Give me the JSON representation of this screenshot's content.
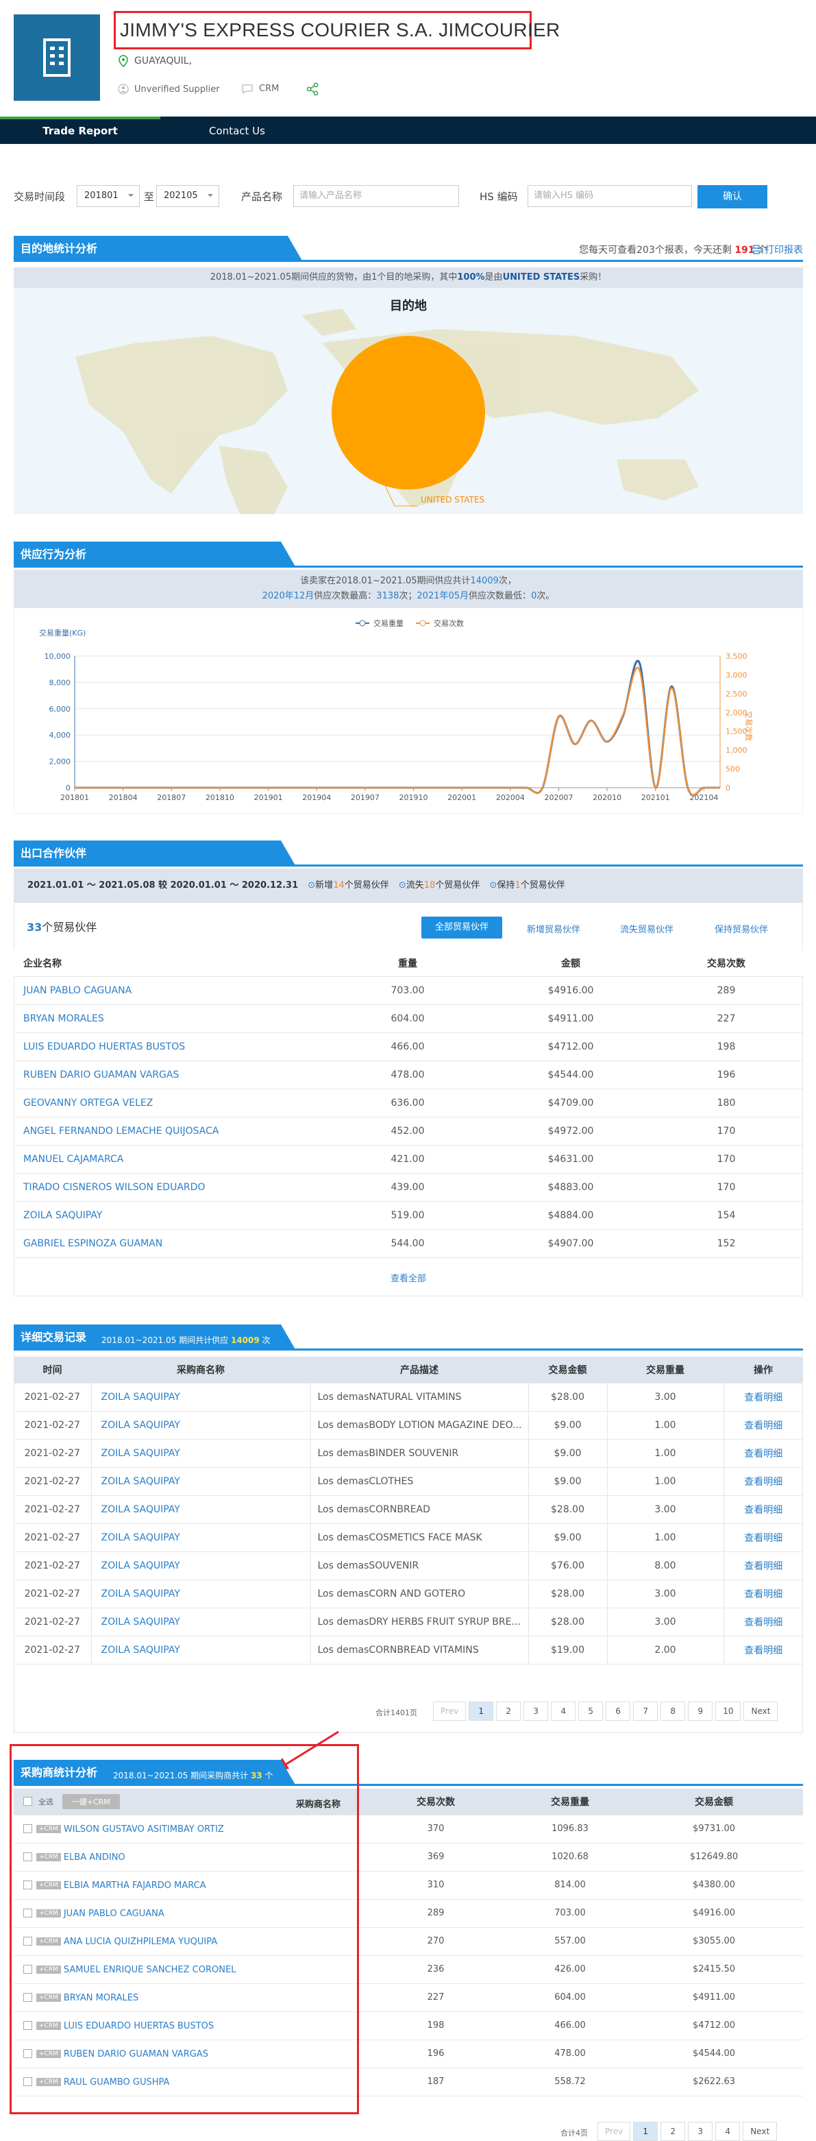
{
  "company": {
    "name": "JIMMY'S EXPRESS COURIER S.A. JIMCOURIER",
    "location": "GUAYAQUIL,",
    "supplier_status": "Unverified Supplier",
    "crm": "CRM"
  },
  "nav": {
    "tabs": [
      "Trade Report",
      "Contact Us"
    ]
  },
  "filters": {
    "period_label": "交易时间段",
    "from": "201801",
    "to_label": "至",
    "to": "202105",
    "product_label": "产品名称",
    "product_placeholder": "请输入产品名称",
    "hs_label": "HS 编码",
    "hs_placeholder": "请输入HS 编码",
    "confirm": "确认"
  },
  "destination": {
    "title": "目的地统计分析",
    "quota_prefix": "您每天可查看203个报表，今天还剩",
    "quota_remaining": "191",
    "quota_suffix": "个",
    "print": "打印报表",
    "summary_a": "2018.01~2021.05期间供应的货物，由1个目的地采购，其中",
    "summary_pct": "100%",
    "summary_b": "是由",
    "summary_country": "UNITED STATES",
    "summary_c": "采购！",
    "chart_title": "目的地",
    "slice_label": "UNITED STATES"
  },
  "supply": {
    "title": "供应行为分析",
    "line1_a": "该卖家在2018.01~2021.05期间供应共计",
    "line1_count": "14009",
    "line1_b": "次，",
    "line2_a": "2020年12月",
    "line2_b": "供应次数最高：",
    "line2_max": "3138",
    "line2_c": "次；",
    "line2_d": "2021年05月",
    "line2_e": "供应次数最低：",
    "line2_min": "0",
    "line2_f": "次。",
    "y_left_title": "交易重量(KG)",
    "y_right_title": "交易次数",
    "legend_weight": "交易重量",
    "legend_count": "交易次数"
  },
  "chart_data": {
    "type": "line",
    "x": [
      "201801",
      "201802",
      "201803",
      "201804",
      "201805",
      "201806",
      "201807",
      "201808",
      "201809",
      "201810",
      "201811",
      "201812",
      "201901",
      "201902",
      "201903",
      "201904",
      "201905",
      "201906",
      "201907",
      "201908",
      "201909",
      "201910",
      "201911",
      "201912",
      "202001",
      "202002",
      "202003",
      "202004",
      "202005",
      "202006",
      "202007",
      "202008",
      "202009",
      "202010",
      "202011",
      "202012",
      "202101",
      "202102",
      "202103",
      "202104",
      "202105"
    ],
    "x_ticks": [
      "201801",
      "201804",
      "201807",
      "201810",
      "201901",
      "201904",
      "201907",
      "201910",
      "202001",
      "202004",
      "202007",
      "202010",
      "202101",
      "202104"
    ],
    "ylim": [
      0,
      10000
    ],
    "y2lim": [
      0,
      3500
    ],
    "y_ticks": [
      "0",
      "2,000",
      "4,000",
      "6,000",
      "8,000",
      "10,000"
    ],
    "y2_ticks": [
      "0",
      "500",
      "1,000",
      "1,500",
      "2,000",
      "2,500",
      "3,000",
      "3,500"
    ],
    "series": [
      {
        "name": "交易重量",
        "axis": "left",
        "color": "#3d6fa8",
        "values": [
          0,
          0,
          0,
          0,
          0,
          0,
          0,
          0,
          0,
          0,
          0,
          0,
          0,
          0,
          0,
          0,
          0,
          0,
          0,
          0,
          0,
          0,
          0,
          0,
          0,
          0,
          0,
          0,
          0,
          0,
          5400,
          3300,
          5100,
          3500,
          5500,
          9500,
          0,
          7700,
          0,
          0,
          0
        ]
      },
      {
        "name": "交易次数",
        "axis": "right",
        "color": "#f0903a",
        "values": [
          0,
          0,
          0,
          0,
          0,
          0,
          0,
          0,
          0,
          0,
          0,
          0,
          0,
          0,
          0,
          0,
          0,
          0,
          0,
          0,
          0,
          0,
          0,
          0,
          0,
          0,
          0,
          0,
          0,
          0,
          1900,
          1150,
          1780,
          1230,
          1950,
          3138,
          0,
          2650,
          0,
          0,
          0
        ]
      }
    ]
  },
  "partners": {
    "title": "出口合作伙伴",
    "period": "2021.01.01 ～ 2021.05.08 较 2020.01.01 ～ 2020.12.31",
    "new_a": "新增",
    "new_n": "14",
    "new_b": "个贸易伙伴",
    "lost_a": "流失",
    "lost_n": "18",
    "lost_b": "个贸易伙伴",
    "kept_a": "保持",
    "kept_n": "1",
    "kept_b": "个贸易伙伴",
    "count": "33",
    "count_suffix": "个贸易伙伴",
    "tabs": [
      "全部贸易伙伴",
      "新增贸易伙伴",
      "流失贸易伙伴",
      "保持贸易伙伴"
    ],
    "columns": [
      "企业名称",
      "重量",
      "金额",
      "交易次数"
    ],
    "rows": [
      [
        "JUAN PABLO CAGUANA",
        "703.00",
        "$4916.00",
        "289"
      ],
      [
        "BRYAN MORALES",
        "604.00",
        "$4911.00",
        "227"
      ],
      [
        "LUIS EDUARDO HUERTAS BUSTOS",
        "466.00",
        "$4712.00",
        "198"
      ],
      [
        "RUBEN DARIO GUAMAN VARGAS",
        "478.00",
        "$4544.00",
        "196"
      ],
      [
        "GEOVANNY ORTEGA VELEZ",
        "636.00",
        "$4709.00",
        "180"
      ],
      [
        "ANGEL FERNANDO LEMACHE QUIJOSACA",
        "452.00",
        "$4972.00",
        "170"
      ],
      [
        "MANUEL CAJAMARCA",
        "421.00",
        "$4631.00",
        "170"
      ],
      [
        "TIRADO CISNEROS WILSON EDUARDO",
        "439.00",
        "$4883.00",
        "170"
      ],
      [
        "ZOILA SAQUIPAY",
        "519.00",
        "$4884.00",
        "154"
      ],
      [
        "GABRIEL ESPINOZA GUAMAN",
        "544.00",
        "$4907.00",
        "152"
      ]
    ],
    "view_all": "查看全部"
  },
  "transactions": {
    "title": "详细交易记录",
    "sub_a": "2018.01~2021.05 期间共计供应",
    "sub_n": "14009",
    "sub_b": "次",
    "columns": [
      "时间",
      "采购商名称",
      "产品描述",
      "交易金额",
      "交易重量",
      "操作"
    ],
    "rows": [
      [
        "2021-02-27",
        "ZOILA SAQUIPAY",
        "Los demasNATURAL VITAMINS",
        "$28.00",
        "3.00",
        "查看明细"
      ],
      [
        "2021-02-27",
        "ZOILA SAQUIPAY",
        "Los demasBODY LOTION MAGAZINE DEO...",
        "$9.00",
        "1.00",
        "查看明细"
      ],
      [
        "2021-02-27",
        "ZOILA SAQUIPAY",
        "Los demasBINDER SOUVENIR",
        "$9.00",
        "1.00",
        "查看明细"
      ],
      [
        "2021-02-27",
        "ZOILA SAQUIPAY",
        "Los demasCLOTHES",
        "$9.00",
        "1.00",
        "查看明细"
      ],
      [
        "2021-02-27",
        "ZOILA SAQUIPAY",
        "Los demasCORNBREAD",
        "$28.00",
        "3.00",
        "查看明细"
      ],
      [
        "2021-02-27",
        "ZOILA SAQUIPAY",
        "Los demasCOSMETICS FACE MASK",
        "$9.00",
        "1.00",
        "查看明细"
      ],
      [
        "2021-02-27",
        "ZOILA SAQUIPAY",
        "Los demasSOUVENIR",
        "$76.00",
        "8.00",
        "查看明细"
      ],
      [
        "2021-02-27",
        "ZOILA SAQUIPAY",
        "Los demasCORN AND GOTERO",
        "$28.00",
        "3.00",
        "查看明细"
      ],
      [
        "2021-02-27",
        "ZOILA SAQUIPAY",
        "Los demasDRY HERBS FRUIT SYRUP BRE...",
        "$28.00",
        "3.00",
        "查看明细"
      ],
      [
        "2021-02-27",
        "ZOILA SAQUIPAY",
        "Los demasCORNBREAD VITAMINS",
        "$19.00",
        "2.00",
        "查看明细"
      ]
    ],
    "total": "合计1401页",
    "pages": [
      "Prev",
      "1",
      "2",
      "3",
      "4",
      "5",
      "6",
      "7",
      "8",
      "9",
      "10",
      "Next"
    ]
  },
  "buyers": {
    "title": "采购商统计分析",
    "sub_a": "2018.01~2021.05 期间采购商共计",
    "sub_n": "33",
    "sub_b": "个",
    "select_all": "全选",
    "bulk_crm": "一键+CRM",
    "columns": [
      "采购商名称",
      "交易次数",
      "交易重量",
      "交易金额"
    ],
    "crm_tag": "+CRM",
    "rows": [
      [
        "WILSON GUSTAVO ASITIMBAY ORTIZ",
        "370",
        "1096.83",
        "$9731.00"
      ],
      [
        "ELBA ANDINO",
        "369",
        "1020.68",
        "$12649.80"
      ],
      [
        "ELBIA MARTHA FAJARDO MARCA",
        "310",
        "814.00",
        "$4380.00"
      ],
      [
        "JUAN PABLO CAGUANA",
        "289",
        "703.00",
        "$4916.00"
      ],
      [
        "ANA LUCIA QUIZHPILEMA YUQUIPA",
        "270",
        "557.00",
        "$3055.00"
      ],
      [
        "SAMUEL ENRIQUE SANCHEZ CORONEL",
        "236",
        "426.00",
        "$2415.50"
      ],
      [
        "BRYAN MORALES",
        "227",
        "604.00",
        "$4911.00"
      ],
      [
        "LUIS EDUARDO HUERTAS BUSTOS",
        "198",
        "466.00",
        "$4712.00"
      ],
      [
        "RUBEN DARIO GUAMAN VARGAS",
        "196",
        "478.00",
        "$4544.00"
      ],
      [
        "RAUL GUAMBO GUSHPA",
        "187",
        "558.72",
        "$2622.63"
      ]
    ],
    "total": "合计4页",
    "pages": [
      "Prev",
      "1",
      "2",
      "3",
      "4",
      "Next"
    ]
  },
  "colors": {
    "accent": "#1d8fe0",
    "nav": "#05253e",
    "highlight": "#e8232a",
    "pie": "#ffa200"
  }
}
